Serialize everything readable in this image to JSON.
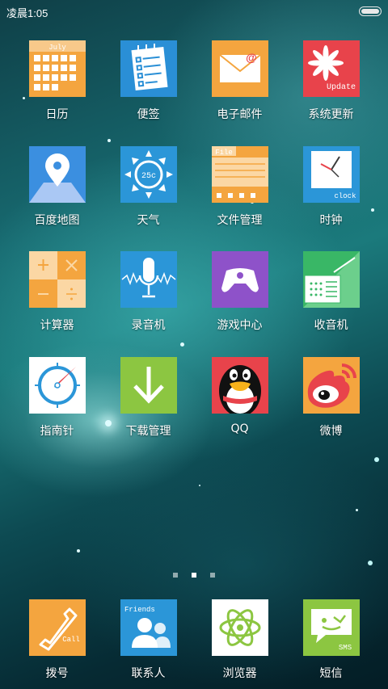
{
  "status": {
    "time": "凌晨1:05"
  },
  "apps": [
    {
      "label": "日历",
      "tile_text": "July",
      "color": "#f4a53f"
    },
    {
      "label": "便签",
      "color": "#2a8fd6"
    },
    {
      "label": "电子邮件",
      "color": "#f4a53f"
    },
    {
      "label": "系统更新",
      "tile_text": "Update",
      "color": "#e8434b"
    },
    {
      "label": "百度地图",
      "color": "#3b8fe0"
    },
    {
      "label": "天气",
      "tile_text": "25c",
      "color": "#2b96d8"
    },
    {
      "label": "文件管理",
      "tile_text": "File",
      "color": "#f4a53f"
    },
    {
      "label": "时钟",
      "tile_text": "clock",
      "color": "#2b96d8"
    },
    {
      "label": "计算器",
      "color": "#f4a53f"
    },
    {
      "label": "录音机",
      "color": "#2b96d8"
    },
    {
      "label": "游戏中心",
      "color": "#8e52c9"
    },
    {
      "label": "收音机",
      "color": "#39b766"
    },
    {
      "label": "指南针",
      "color": "#ffffff"
    },
    {
      "label": "下载管理",
      "color": "#8cc641"
    },
    {
      "label": "QQ",
      "color": "#e8434b"
    },
    {
      "label": "微博",
      "color": "#f4a53f"
    }
  ],
  "page_indicator": {
    "count": 3,
    "active": 2
  },
  "dock": [
    {
      "label": "拨号",
      "tile_text": "Call",
      "color": "#f4a53f"
    },
    {
      "label": "联系人",
      "tile_text": "Friends",
      "color": "#2b96d8"
    },
    {
      "label": "浏览器",
      "color": "#ffffff"
    },
    {
      "label": "短信",
      "tile_text": "SMS",
      "color": "#8cc641"
    }
  ]
}
